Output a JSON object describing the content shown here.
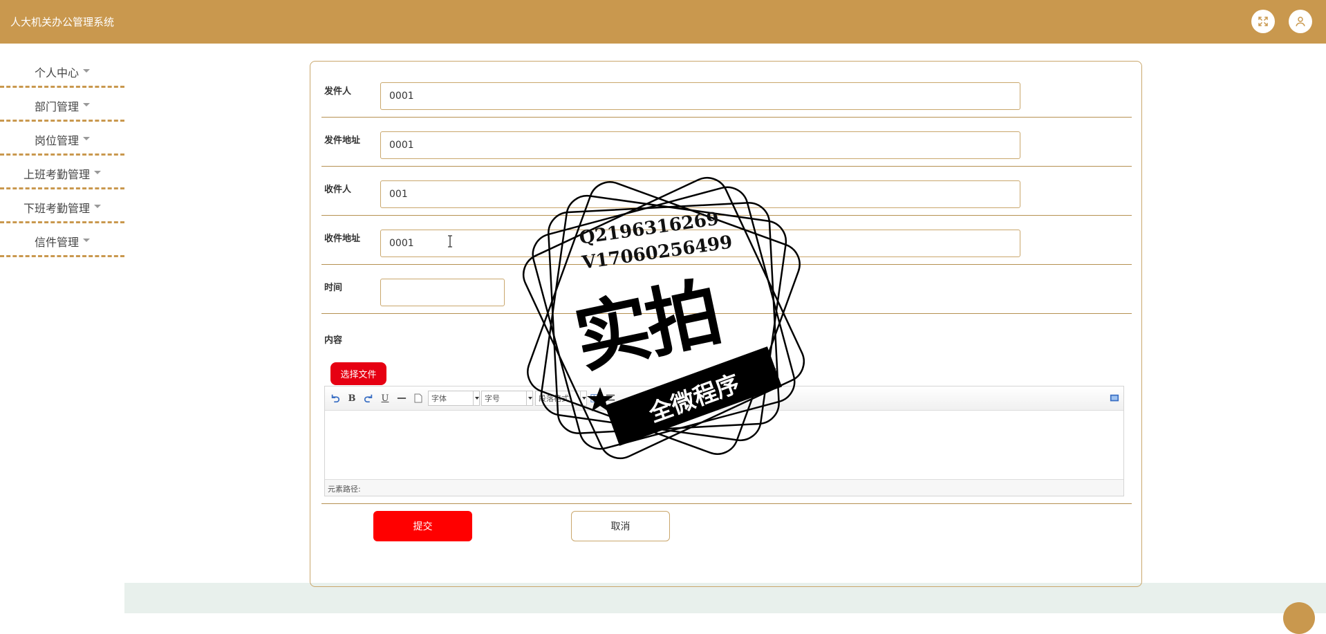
{
  "header": {
    "app_title": "人大机关办公管理系统",
    "fullscreen_icon": "expand-icon",
    "user_icon": "user-icon"
  },
  "sidebar": {
    "items": [
      {
        "label": "个人中心"
      },
      {
        "label": "部门管理"
      },
      {
        "label": "岗位管理"
      },
      {
        "label": "上班考勤管理"
      },
      {
        "label": "下班考勤管理"
      },
      {
        "label": "信件管理"
      }
    ]
  },
  "form": {
    "sender_label": "发件人",
    "sender_value": "0001",
    "sender_address_label": "发件地址",
    "sender_address_value": "0001",
    "recipient_label": "收件人",
    "recipient_value": "001",
    "recipient_address_label": "收件地址",
    "recipient_address_value": "0001",
    "time_label": "时间",
    "time_value": "",
    "content_label": "内容",
    "choose_file_label": "选择文件",
    "submit_label": "提交",
    "cancel_label": "取消"
  },
  "editor": {
    "font_family_select": "字体",
    "font_size_select": "字号",
    "paragraph_select": "段落格式",
    "element_path_label": "元素路径:",
    "toolbar_icons": [
      "undo-icon",
      "bold-icon",
      "redo-icon",
      "underline-icon",
      "horizontal-rule-icon",
      "paste-plain-icon",
      "source-icon"
    ]
  },
  "watermark": {
    "line1": "Q2196316269",
    "line2": "V17060256499",
    "big_text": "实拍",
    "banner_text": "全微程序"
  },
  "colors": {
    "brand": "#c9984e",
    "danger": "#ff0000",
    "footer_band": "#e8f0ec"
  }
}
